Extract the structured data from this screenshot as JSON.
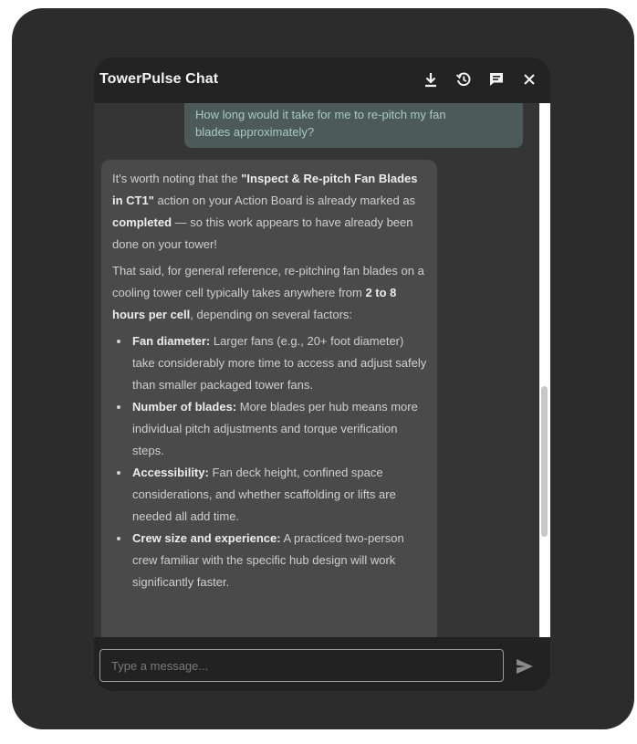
{
  "app": {
    "title": "TowerPulse Chat"
  },
  "header": {
    "icons": [
      "download-icon",
      "history-icon",
      "chat-icon",
      "close-icon"
    ]
  },
  "messages": {
    "user": {
      "line1": "How long would it take for me to re-pitch my fan",
      "line2": "blades approximately?"
    },
    "bot": {
      "p1_start": "It's worth noting that the ",
      "p1_bold1": "\"Inspect & Re-pitch Fan Blades in CT1\"",
      "p1_mid": " action on your Action Board is already marked as ",
      "p1_bold2": "completed",
      "p1_end": " — so this work appears to have already been done on your tower!",
      "p2_start": "That said, for general reference, re-pitching fan blades on a cooling tower cell typically takes anywhere from ",
      "p2_bold": "2 to 8 hours per cell",
      "p2_end": ", depending on several factors:",
      "bullets": [
        {
          "label": "Fan diameter:",
          "text": " Larger fans (e.g., 20+ foot diameter) take considerably more time to access and adjust safely than smaller packaged tower fans."
        },
        {
          "label": "Number of blades:",
          "text": " More blades per hub means more individual pitch adjustments and torque verification steps."
        },
        {
          "label": "Accessibility:",
          "text": " Fan deck height, confined space considerations, and whether scaffolding or lifts are needed all add time."
        },
        {
          "label": "Crew size and experience:",
          "text": " A practiced two-person crew familiar with the specific hub design will work significantly faster."
        }
      ]
    }
  },
  "composer": {
    "placeholder": "Type a message...",
    "value": ""
  },
  "colors": {
    "frame": "#2c2c2c",
    "window": "#202020",
    "messages_bg": "#353535",
    "user_bubble": "#4c5b59",
    "bot_bubble": "#4a4a4a"
  }
}
